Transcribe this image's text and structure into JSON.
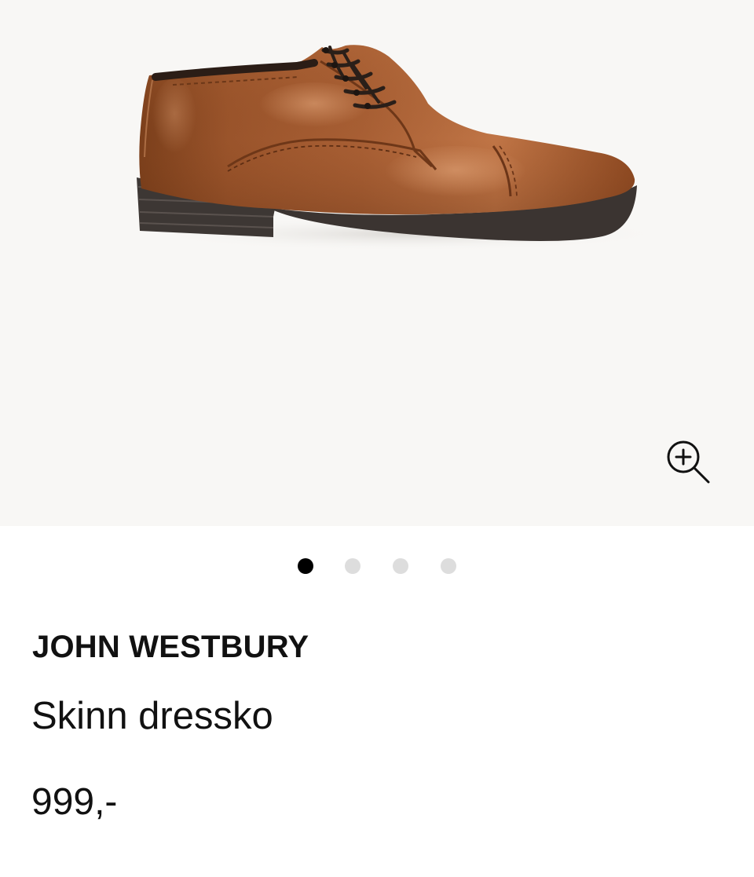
{
  "gallery": {
    "background_color": "#f8f7f5",
    "image_description_icon": "shoe-image",
    "zoom_icon": "zoom-in-icon",
    "slide_count": 4,
    "active_slide": 1
  },
  "product": {
    "brand": "JOHN WESTBURY",
    "name": "Skinn dressko",
    "price": "999,-"
  },
  "colors": {
    "active_dot": "#000000",
    "inactive_dot": "#dddddd",
    "text": "#111111",
    "leather_brown": "#8a4a20"
  }
}
